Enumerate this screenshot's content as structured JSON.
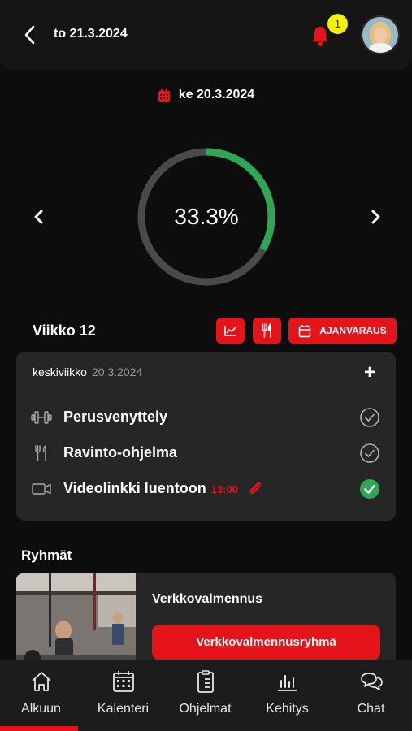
{
  "header": {
    "title": "to 21.3.2024",
    "notification_count": "1",
    "back_icon": "chevron-left-icon",
    "bell_icon": "bell-icon"
  },
  "date_selector": {
    "date": "ke 20.3.2024",
    "icon": "calendar-icon"
  },
  "progress": {
    "label": "33.3%",
    "fraction": 0.333,
    "color": "#2fa655"
  },
  "week": {
    "title": "Viikko 12",
    "booking_label": "AJANVARAUS"
  },
  "day_card": {
    "weekday": "keskiviikko",
    "date": "20.3.2024",
    "items": [
      {
        "label": "Perusvenyttely",
        "time": "",
        "icon": "dumbbell-icon",
        "done": false
      },
      {
        "label": "Ravinto-ohjelma",
        "time": "",
        "icon": "fork-knife-icon",
        "done": false
      },
      {
        "label": "Videolinkki luentoon",
        "time": "13:00",
        "icon": "video-camera-icon",
        "done": true
      }
    ]
  },
  "groups": {
    "title": "Ryhmät",
    "card": {
      "name": "Verkkovalmennus",
      "button_label": "Verkkovalmennusryhmä"
    }
  },
  "tabs": [
    {
      "label": "Alkuun",
      "icon": "home-icon",
      "active": true
    },
    {
      "label": "Kalenteri",
      "icon": "calendar-grid-icon",
      "active": false
    },
    {
      "label": "Ohjelmat",
      "icon": "clipboard-list-icon",
      "active": false
    },
    {
      "label": "Kehitys",
      "icon": "bar-chart-icon",
      "active": false
    },
    {
      "label": "Chat",
      "icon": "chat-bubbles-icon",
      "active": false
    }
  ],
  "colors": {
    "accent": "#e4141a",
    "success": "#2fa655",
    "badge": "#f3f00a",
    "background": "#0d0d0d",
    "card": "#262626"
  }
}
